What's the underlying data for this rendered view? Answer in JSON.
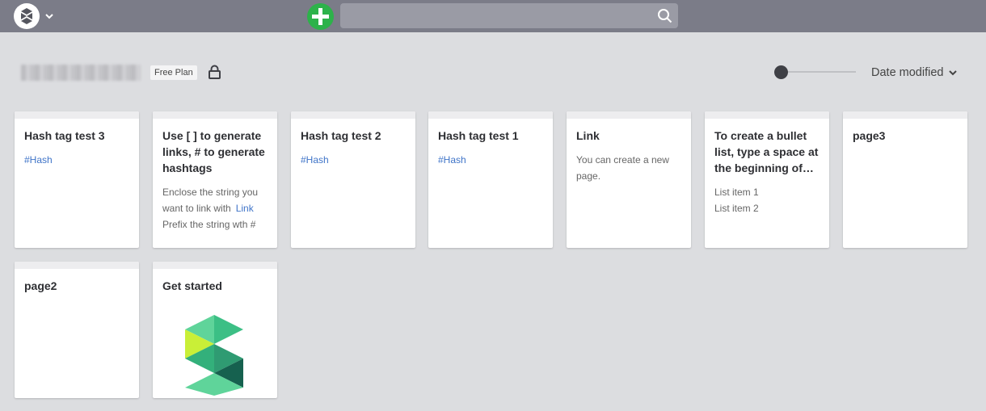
{
  "topbar": {
    "search_placeholder": "",
    "accent_add": "#2db24a",
    "bar_color": "#7b7c88"
  },
  "header": {
    "plan_badge": "Free Plan",
    "sort_label": "Date modified"
  },
  "cards": [
    {
      "title": "Hash tag test 3",
      "lines": [
        "#Hash"
      ]
    },
    {
      "title": "Use [ ] to generate links, # to generate hashtags",
      "lines": [
        "Enclose the string you",
        "want to link with",
        "Prefix the string wth #"
      ],
      "link_text": "Link"
    },
    {
      "title": "Hash tag test 2",
      "lines": [
        "#Hash"
      ]
    },
    {
      "title": "Hash tag test 1",
      "lines": [
        "#Hash"
      ]
    },
    {
      "title": "Link",
      "lines": [
        "You can create a new",
        "page."
      ]
    },
    {
      "title": "To create a bullet list, type a space at the beginning of a...",
      "lines": [
        "List item 1",
        "List item 2"
      ]
    },
    {
      "title": "page3",
      "lines": []
    },
    {
      "title": "page2",
      "lines": []
    },
    {
      "title": "Get started",
      "lines": []
    }
  ]
}
